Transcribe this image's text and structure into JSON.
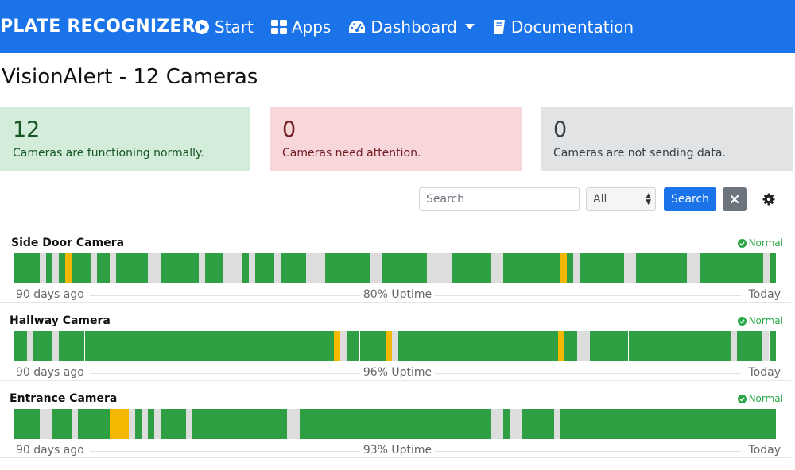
{
  "navbar": {
    "brand": "PLATE RECOGNIZER",
    "items": [
      {
        "label": "Start",
        "icon": "play-circle-icon"
      },
      {
        "label": "Apps",
        "icon": "grid-icon"
      },
      {
        "label": "Dashboard",
        "icon": "tachometer-icon",
        "dropdown": true
      },
      {
        "label": "Documentation",
        "icon": "book-icon"
      }
    ]
  },
  "page": {
    "title": "VisionAlert - 12 Cameras"
  },
  "summary": {
    "ok": {
      "count": "12",
      "text": "Cameras are functioning normally."
    },
    "attention": {
      "count": "0",
      "text": "Cameras need attention."
    },
    "offline": {
      "count": "0",
      "text": "Cameras are not sending data."
    }
  },
  "toolbar": {
    "search_placeholder": "Search",
    "filter_value": "All",
    "search_label": "Search"
  },
  "timeline_labels": {
    "start": "90 days ago",
    "end": "Today"
  },
  "colors": {
    "up": "#2ea043",
    "warn": "#f5b800",
    "none": "#dddddd",
    "primary": "#1a73e8",
    "normal": "#28a745"
  },
  "cameras": [
    {
      "name": "Side Door Camera",
      "status": "Normal",
      "uptime": "80% Uptime",
      "history": "UUUUNUNUWUUUNUUNUUUUUNNUUUUUUNUUUNNNUNUUUNUUUUNNNUUUUUUUNNUUUUUUUNNNNUUUUUUNNUUUUUUUUUWUNUUUUUUUNNUUUUUUUUNNUUUUUUUUUUNU"
    },
    {
      "name": "Hallway Camera",
      "status": "Normal",
      "uptime": "96% Uptime",
      "history": "UUNUUUNUUUUUUUUUUUUUUUUUUUUUUUUUUUUUUUUUUUUUUUUUUUWNUUUUUUWNUUUUUUUUUUUUUUUUUUUUUUUUUWUUNNUUUUUUUUUUUUUUUUUUUUUUNUUUUNU"
    },
    {
      "name": "Entrance Camera",
      "status": "Normal",
      "uptime": "93% Uptime",
      "history": "UUUUNNUUUNUUUUUWWWNUNUNUUUUNUUUUUUUUUUUUUUUNNUUUUUUUUUUUUUUUUUUUUUUUUUUUUUUNNUNNUUUUUNUUUUUUUUUUUUUUUUUUUUUUUUUUUUUUUUUU"
    }
  ]
}
